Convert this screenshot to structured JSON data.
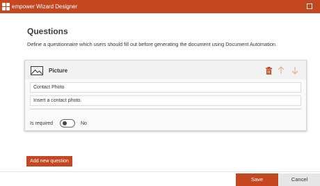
{
  "window": {
    "title": "empower Wizard Designer",
    "app_icon": "empower-logo-icon",
    "maximize_icon": "maximize-icon",
    "accent_color": "#c4471f"
  },
  "page": {
    "title": "Questions",
    "description": "Define a questionnaire which users should fill out before generating the document using Document Automation."
  },
  "question": {
    "type_icon": "picture-icon",
    "type_label": "Picture",
    "name_value": "Contact Photo",
    "description_value": "Insert a contact photo.",
    "actions": {
      "delete_icon": "trash-icon",
      "move_up_icon": "arrow-up-icon",
      "move_down_icon": "arrow-down-icon"
    },
    "required": {
      "label": "Is required",
      "on": false,
      "state_label": "No"
    }
  },
  "buttons": {
    "add_question": "Add new question",
    "save": "Save",
    "cancel": "Cancel"
  }
}
